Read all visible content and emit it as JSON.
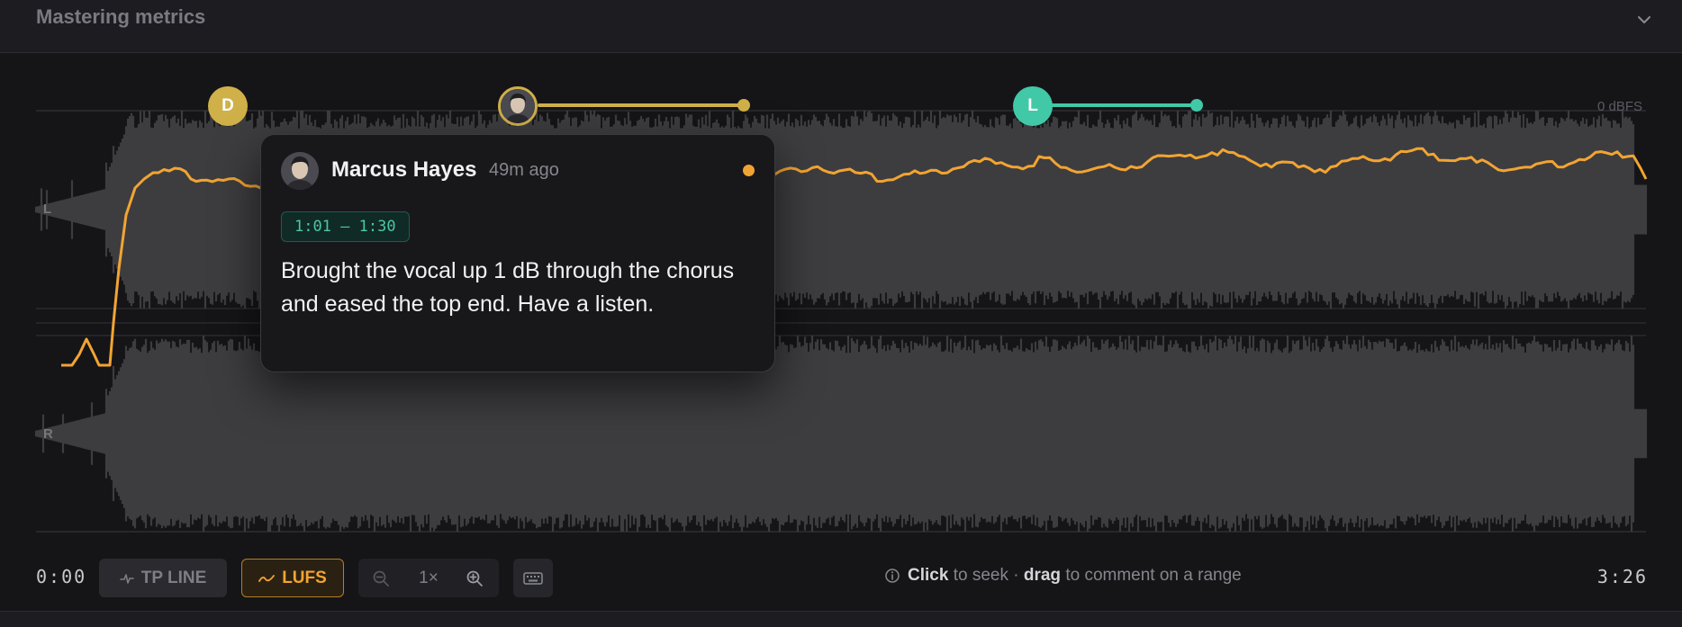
{
  "header": {
    "title": "Mastering metrics",
    "collapse_icon": "chevron-down-icon"
  },
  "waveform": {
    "scale_label": "0 dBFS",
    "channels": [
      "L",
      "R"
    ],
    "lufs_color": "#f2a432",
    "waveform_color": "#3d3d40"
  },
  "markers": [
    {
      "id": "d",
      "label": "D",
      "color": "#d0b048"
    },
    {
      "id": "marcus",
      "label": "",
      "color": "#d0b048",
      "has_range": true
    },
    {
      "id": "l",
      "label": "L",
      "color": "#41c9a7",
      "has_range": true
    }
  ],
  "comment": {
    "author": "Marcus Hayes",
    "time_ago": "49m ago",
    "range": "1:01 — 1:30",
    "body": "Brought the vocal up 1 dB through the chorus and eased the top end. Have a listen.",
    "unread_color": "#f2a432"
  },
  "controls": {
    "current_time": "0:00",
    "duration": "3:26",
    "tp_line_label": "TP LINE",
    "tp_line_active": false,
    "lufs_label": "LUFS",
    "lufs_active": true,
    "zoom_level": "1×"
  },
  "hint": {
    "click": "Click",
    "click_text": "to seek ·",
    "drag": "drag",
    "drag_text": "to comment on a range"
  }
}
